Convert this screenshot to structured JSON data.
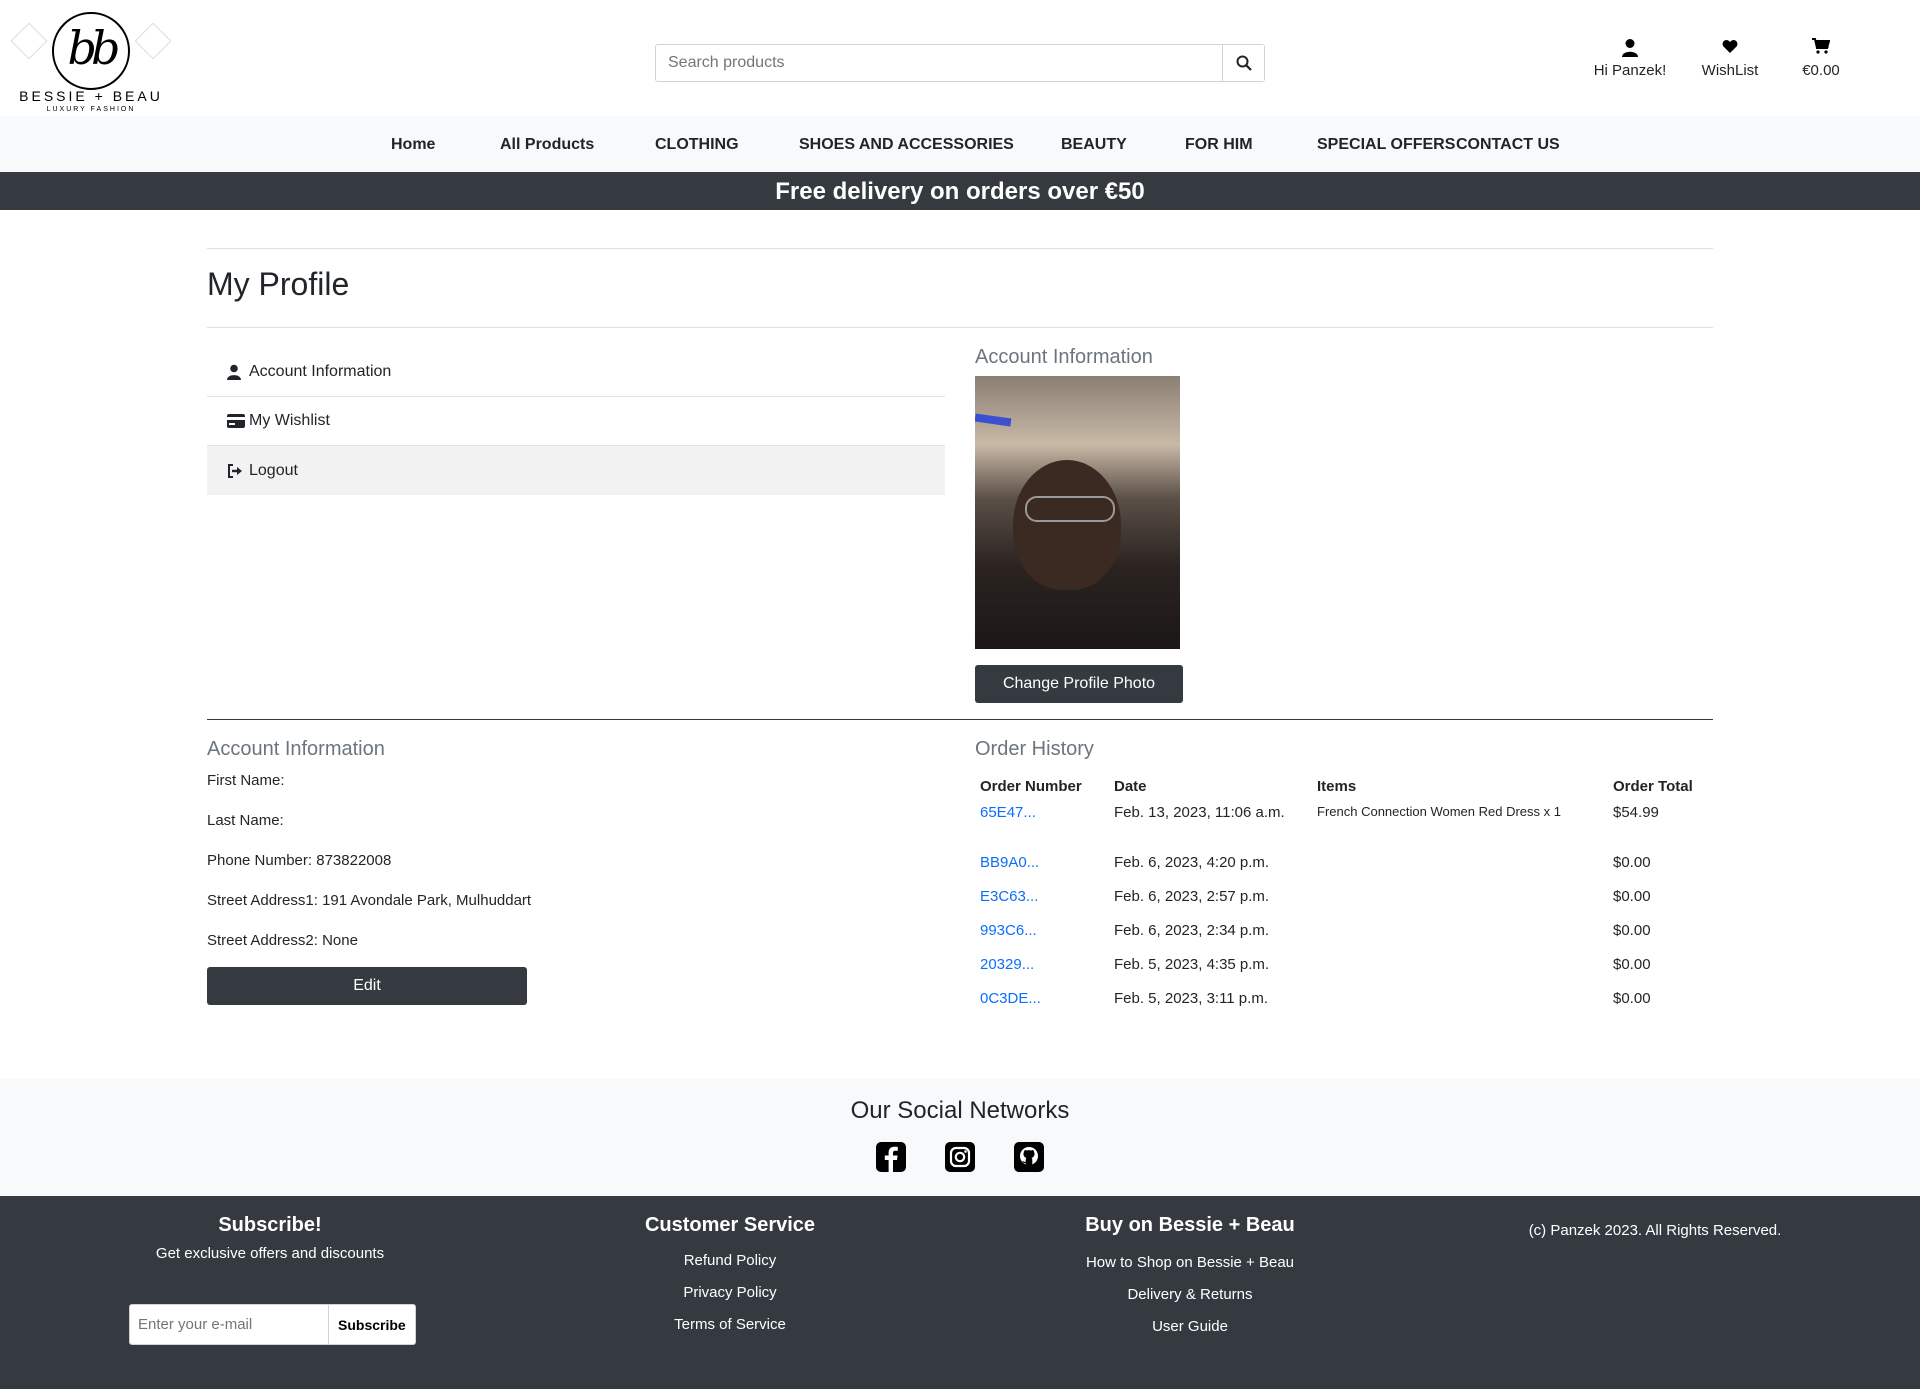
{
  "header": {
    "logo_brand": "BESSIE + BEAU",
    "logo_sub": "LUXURY FASHION",
    "logo_mono": "bb",
    "search_placeholder": "Search products",
    "account_label": "Hi Panzek!",
    "wishlist_label": "WishList",
    "cart_total": "€0.00"
  },
  "nav": {
    "items": [
      "Home",
      "All Products",
      "CLOTHING",
      "SHOES AND ACCESSORIES",
      "BEAUTY",
      "FOR HIM",
      "SPECIAL OFFERS",
      "CONTACT US"
    ]
  },
  "banner": "Free delivery on orders over €50",
  "profile": {
    "title": "My Profile",
    "menu": [
      "Account Information",
      "My Wishlist",
      "Logout"
    ],
    "photo_section_title": "Account Information",
    "change_photo_label": "Change Profile Photo",
    "account_section_title": "Account Information",
    "fields": [
      "First Name:",
      "Last Name:",
      "Phone Number: 873822008",
      "Street Address1: 191 Avondale Park, Mulhuddart",
      "Street Address2: None"
    ],
    "edit_label": "Edit"
  },
  "orders": {
    "title": "Order History",
    "columns": [
      "Order Number",
      "Date",
      "Items",
      "Order Total"
    ],
    "rows": [
      {
        "number": "65E47...",
        "date": "Feb. 13, 2023, 11:06 a.m.",
        "items": "French Connection Women Red Dress x 1",
        "total": "$54.99"
      },
      {
        "number": "BB9A0...",
        "date": "Feb. 6, 2023, 4:20 p.m.",
        "items": "",
        "total": "$0.00"
      },
      {
        "number": "E3C63...",
        "date": "Feb. 6, 2023, 2:57 p.m.",
        "items": "",
        "total": "$0.00"
      },
      {
        "number": "993C6...",
        "date": "Feb. 6, 2023, 2:34 p.m.",
        "items": "",
        "total": "$0.00"
      },
      {
        "number": "20329...",
        "date": "Feb. 5, 2023, 4:35 p.m.",
        "items": "",
        "total": "$0.00"
      },
      {
        "number": "0C3DE...",
        "date": "Feb. 5, 2023, 3:11 p.m.",
        "items": "",
        "total": "$0.00"
      }
    ]
  },
  "social": {
    "title": "Our Social Networks",
    "icons": [
      "facebook-icon",
      "instagram-icon",
      "github-icon"
    ]
  },
  "footer": {
    "subscribe_title": "Subscribe!",
    "subscribe_text": "Get exclusive offers and discounts",
    "email_placeholder": "Enter your e-mail",
    "subscribe_button": "Subscribe",
    "customer_service_title": "Customer Service",
    "customer_service_links": [
      "Refund Policy",
      "Privacy Policy",
      "Terms of Service"
    ],
    "buy_title": "Buy on Bessie + Beau",
    "buy_links": [
      "How to Shop on Bessie + Beau",
      "Delivery & Returns",
      "User Guide"
    ],
    "copyright": "(c) Panzek 2023. All Rights Reserved."
  },
  "colors": {
    "dark": "#343a40",
    "light": "#f8f9fa",
    "link": "#0d6efd",
    "muted": "#6c757d"
  }
}
